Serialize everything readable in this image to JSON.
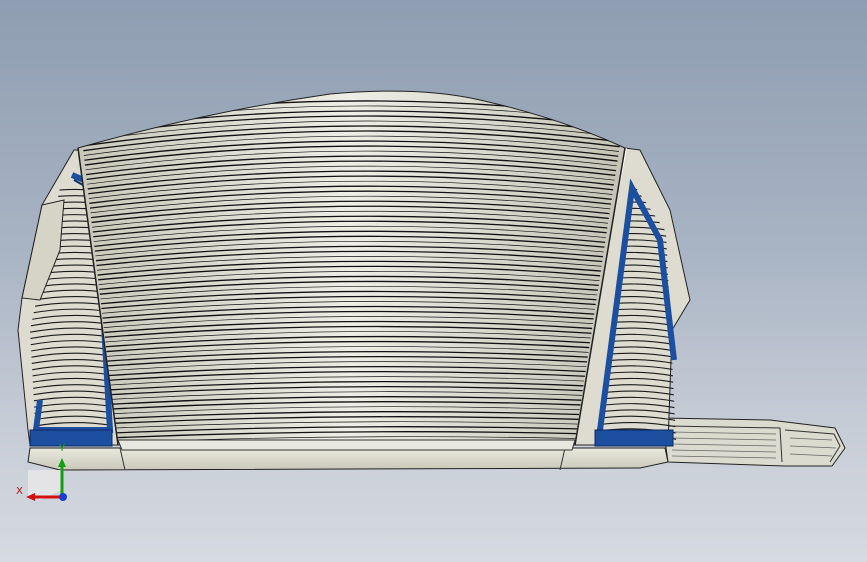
{
  "viewport": {
    "background_top": "#8e9db1",
    "background_bottom": "#d6dae1"
  },
  "model": {
    "body_color": "#dddcd0",
    "stripe_color": "#111111",
    "accent_color": "#1d4fa0"
  },
  "triad": {
    "x_label": "X",
    "y_label": "Y",
    "x_color": "#d01010",
    "y_color": "#10a010",
    "z_color": "#1a3cd0"
  }
}
